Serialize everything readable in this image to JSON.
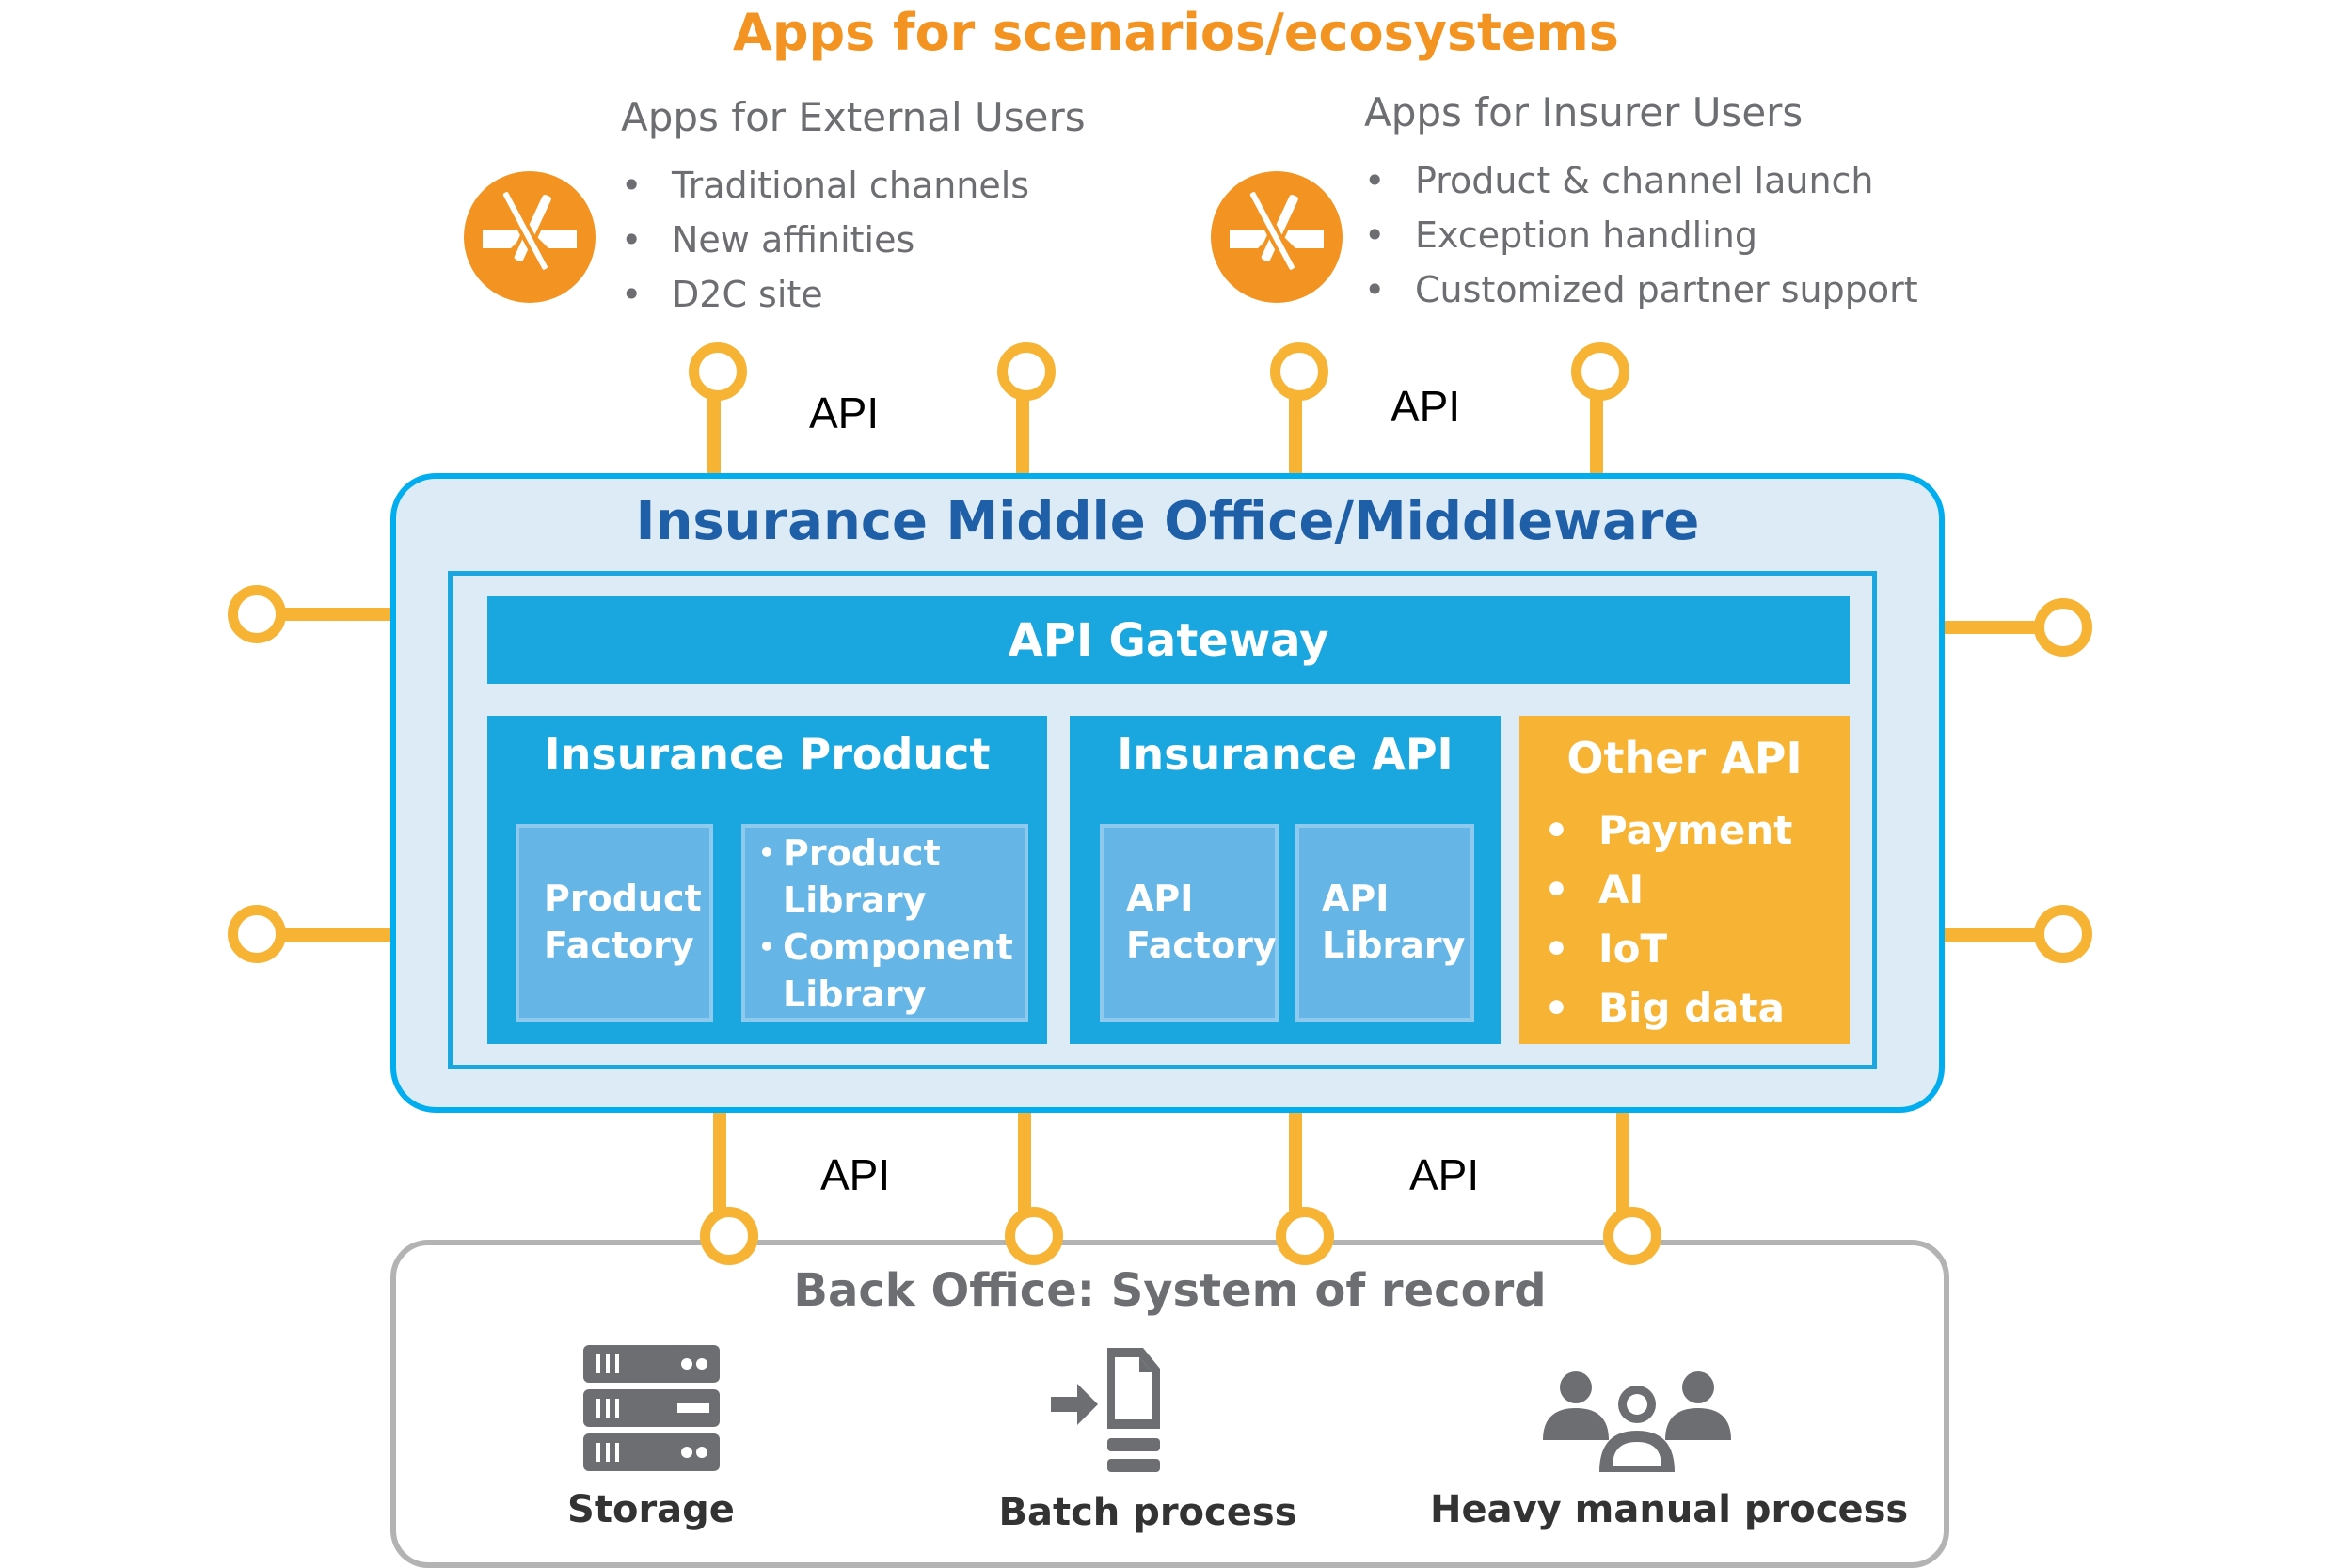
{
  "title": "Apps for scenarios/ecosystems",
  "colors": {
    "orange_title": "#f39422",
    "connector_orange": "#f7b334",
    "middleware_border": "#00aeef",
    "middleware_bg": "#ddebf7",
    "panel_blue": "#1aa7df",
    "sub_panel_blue": "#65b6e6",
    "other_api_orange": "#f7b334",
    "middle_title_blue": "#1f5fa8",
    "gray_text": "#6d6e71",
    "back_office_border": "#b3b3b3"
  },
  "app_groups": [
    {
      "title": "Apps for External Users",
      "icon": "app-store-icon",
      "items": [
        "Traditional channels",
        "New affinities",
        "D2C site"
      ]
    },
    {
      "title": "Apps for Insurer Users",
      "icon": "app-store-icon",
      "items": [
        "Product & channel launch",
        "Exception handling",
        "Customized partner support"
      ]
    }
  ],
  "api_labels": {
    "top_left": "API",
    "top_right": "API",
    "bottom_left": "API",
    "bottom_right": "API"
  },
  "middleware": {
    "title": "Insurance Middle Office/Middleware",
    "gateway": "API Gateway",
    "insurance_product": {
      "title": "Insurance Product",
      "factory": [
        "Product",
        "Factory"
      ],
      "libraries": [
        {
          "bullet": "•",
          "lines": [
            "Product",
            "Library"
          ]
        },
        {
          "bullet": "•",
          "lines": [
            "Component",
            "Library"
          ]
        }
      ]
    },
    "insurance_api": {
      "title": "Insurance API",
      "factory": [
        "API",
        "Factory"
      ],
      "library": [
        "API",
        "Library"
      ]
    },
    "other_api": {
      "title": "Other API",
      "items": [
        "Payment",
        "AI",
        "IoT",
        "Big data"
      ]
    }
  },
  "back_office": {
    "title": "Back Office: System of record",
    "items": [
      {
        "label": "Storage",
        "icon": "server-storage-icon"
      },
      {
        "label": "Batch process",
        "icon": "batch-document-icon"
      },
      {
        "label": "Heavy manual process",
        "icon": "people-group-icon"
      }
    ]
  }
}
